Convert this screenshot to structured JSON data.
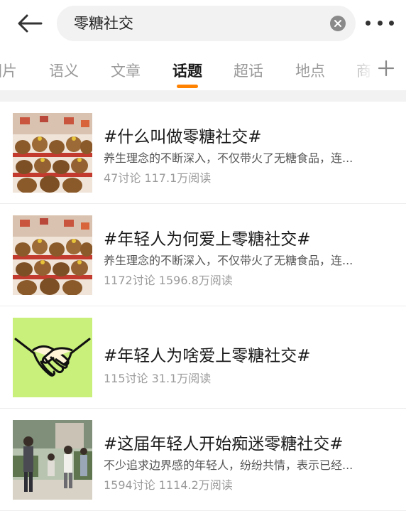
{
  "search": {
    "query": "零糖社交",
    "back_icon": "arrow-left-icon",
    "clear_icon": "close-circle-icon",
    "more_icon": "more-dots-icon"
  },
  "tabs": {
    "items": [
      {
        "label": "图片",
        "active": false
      },
      {
        "label": "语义",
        "active": false
      },
      {
        "label": "文章",
        "active": false
      },
      {
        "label": "话题",
        "active": true
      },
      {
        "label": "超话",
        "active": false
      },
      {
        "label": "地点",
        "active": false
      },
      {
        "label": "商",
        "active": false
      }
    ],
    "add_icon": "plus-icon",
    "accent_color": "#ff8200"
  },
  "results": [
    {
      "title": "#什么叫做零糖社交#",
      "description": "养生理念的不断深入，不仅带火了无糖食品，连...",
      "stats": "47讨论 117.1万阅读",
      "thumbnail": "plush-toys-image"
    },
    {
      "title": "#年轻人为何爱上零糖社交#",
      "description": "养生理念的不断深入，不仅带火了无糖食品，连...",
      "stats": "1172讨论 1596.8万阅读",
      "thumbnail": "plush-toys-image"
    },
    {
      "title": "#年轻人为啥爱上零糖社交#",
      "description": "",
      "stats": "115讨论 31.1万阅读",
      "thumbnail": "handshake-icon"
    },
    {
      "title": "#这届年轻人开始痴迷零糖社交#",
      "description": "不少追求边界感的年轻人，纷纷共情，表示已经...",
      "stats": "1594讨论 1114.2万阅读",
      "thumbnail": "people-outdoors-image"
    }
  ]
}
